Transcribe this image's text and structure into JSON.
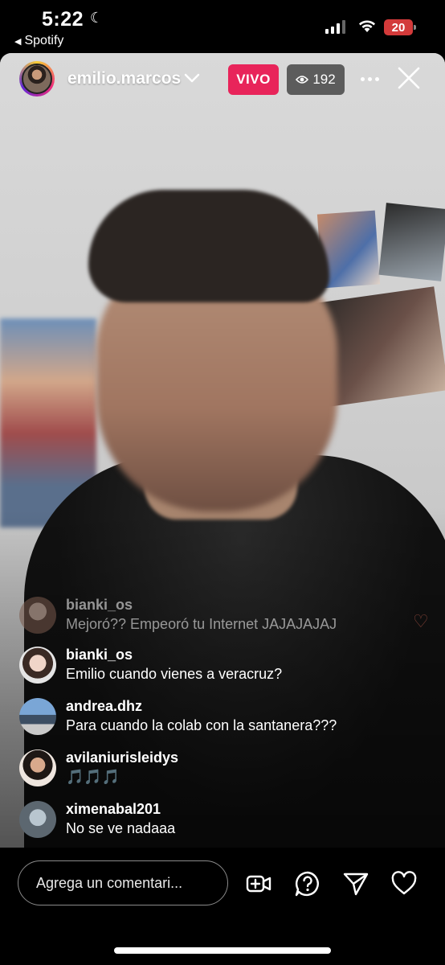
{
  "status_bar": {
    "time": "5:22",
    "back_app": "Spotify",
    "battery": "20"
  },
  "live": {
    "host_username": "emilio.marcos",
    "live_badge": "VIVO",
    "viewer_count": "192"
  },
  "comments": [
    {
      "username": "bianki_os",
      "text": "Mejoró?? Empeoró tu Internet JAJAJAJAJ"
    },
    {
      "username": "bianki_os",
      "text": "Emilio cuando vienes a veracruz?"
    },
    {
      "username": "andrea.dhz",
      "text": "Para cuando la colab con la santanera???"
    },
    {
      "username": "avilaniurisleidys",
      "text": "🎵🎵🎵"
    },
    {
      "username": "ximenabal201",
      "text": "No se ve nadaaa"
    }
  ],
  "bottom_bar": {
    "comment_placeholder": "Agrega un comentari..."
  },
  "colors": {
    "live_badge": "#e8245a",
    "background": "#000000",
    "battery_low": "#d33a3a"
  },
  "icons": [
    "moon-icon",
    "signal-icon",
    "wifi-icon",
    "battery-icon",
    "chevron-down-icon",
    "eye-icon",
    "more-icon",
    "close-icon",
    "add-video-icon",
    "question-icon",
    "send-icon",
    "heart-icon"
  ]
}
